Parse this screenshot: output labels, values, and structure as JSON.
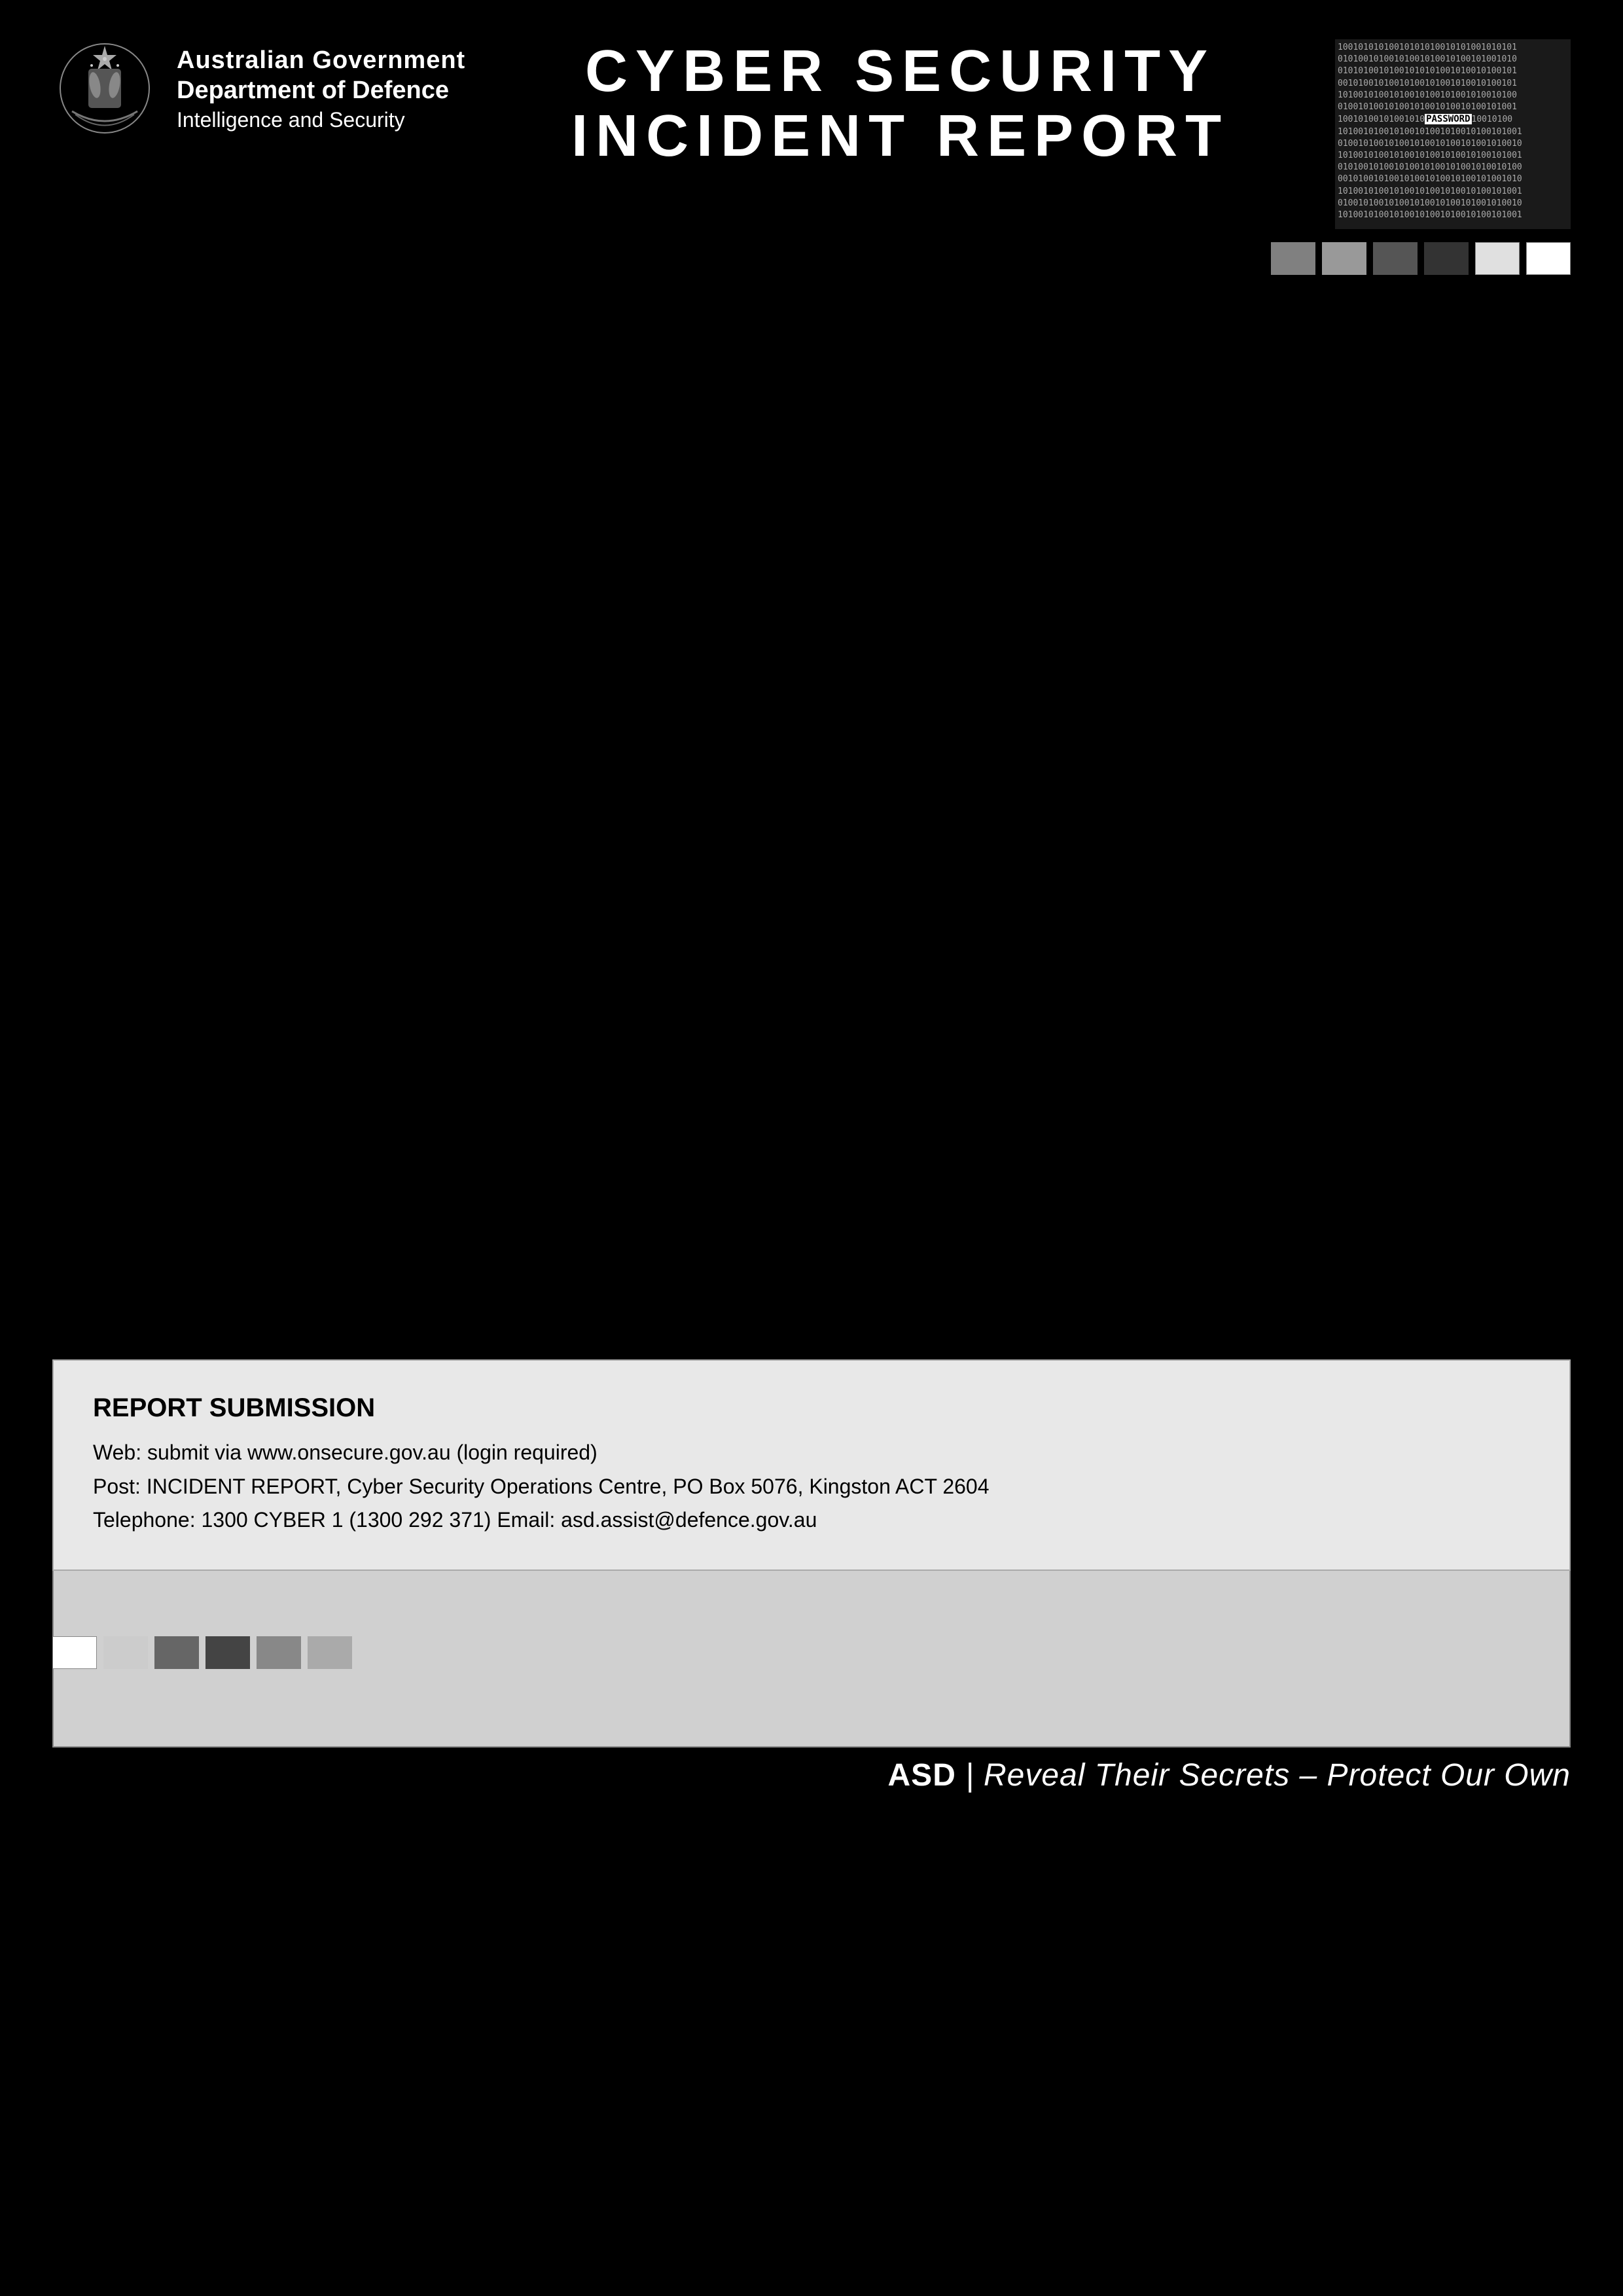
{
  "header": {
    "org_line1": "Australian Government",
    "org_line2": "Department of Defence",
    "org_line3": "Intelligence and Security",
    "title_line1": "CYBER SECURITY",
    "title_line2": "INCIDENT REPORT"
  },
  "color_blocks_top": [
    {
      "color": "#808080",
      "label": "gray-1"
    },
    {
      "color": "#999999",
      "label": "gray-2"
    },
    {
      "color": "#555555",
      "label": "gray-dark-1"
    },
    {
      "color": "#333333",
      "label": "gray-dark-2"
    },
    {
      "color": "#cccccc",
      "label": "light-1"
    },
    {
      "color": "#ffffff",
      "label": "white"
    },
    {
      "color": "#f0f0f0",
      "label": "near-white"
    }
  ],
  "color_blocks_bottom": [
    {
      "color": "#ffffff",
      "label": "white-b"
    },
    {
      "color": "#cccccc",
      "label": "light-b"
    },
    {
      "color": "#666666",
      "label": "dark-b-1"
    },
    {
      "color": "#444444",
      "label": "dark-b-2"
    },
    {
      "color": "#888888",
      "label": "mid-b-1"
    },
    {
      "color": "#aaaaaa",
      "label": "mid-b-2"
    }
  ],
  "binary_lines": [
    "10010101010010101010010101001010101",
    "01010010100101001010010100101001010",
    "01010100101001010101001010010100101",
    "00101001010010100101001010010100101",
    "10100101001010010100101001010010100",
    "01001010010100101001010010100101001",
    "10010100101001010010100101001010010",
    "01010010100101001010010100101001010",
    "00101001010010100101001010010100101",
    "10100101001010010100101001010010100",
    "01001010010100101001010010100101001",
    "10010100101001010010100101001010010",
    "01010010100101001010010100101001010",
    "00101001010010100101001010010100101",
    "10100101001010010100101001010010100"
  ],
  "password_word": "PASSWORD",
  "report_submission": {
    "title": "REPORT SUBMISSION",
    "line1": "Web: submit via www.onsecure.gov.au (login required)",
    "line2": "Post: INCIDENT REPORT, Cyber Security Operations Centre, PO Box 5076, Kingston ACT 2604",
    "line3": "Telephone: 1300 CYBER 1 (1300 292 371)  Email: asd.assist@defence.gov.au"
  },
  "tagline": {
    "org": "ASD",
    "text": "Reveal Their Secrets – Protect Our Own"
  }
}
